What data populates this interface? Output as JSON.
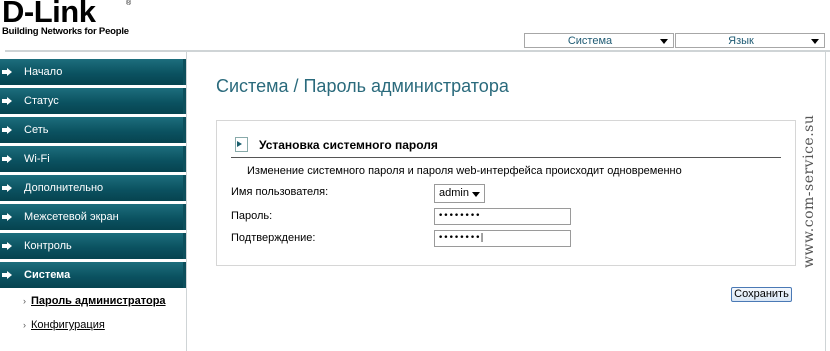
{
  "brand": {
    "logo_text": "D-Link",
    "registered_mark": "®",
    "tagline": "Building Networks for People"
  },
  "topbar": {
    "system_select": "Система",
    "language_select": "Язык"
  },
  "sidebar": {
    "items": [
      {
        "label": "Начало"
      },
      {
        "label": "Статус"
      },
      {
        "label": "Сеть"
      },
      {
        "label": "Wi-Fi"
      },
      {
        "label": "Дополнительно"
      },
      {
        "label": "Межсетевой экран"
      },
      {
        "label": "Контроль"
      },
      {
        "label": "Система"
      }
    ],
    "sub_items": [
      {
        "label": "Пароль администратора"
      },
      {
        "label": "Конфигурация"
      }
    ]
  },
  "main": {
    "title": "Система  / Пароль администратора",
    "section_title": "Установка системного пароля",
    "description": "Изменение системного пароля и пароля web-интерфейса происходит одновременно",
    "fields": {
      "username_label": "Имя пользователя:",
      "username_value": "admin",
      "password_label": "Пароль:",
      "password_value": "••••••••",
      "confirm_label": "Подтверждение:",
      "confirm_value": "••••••••|"
    },
    "save_label": "Сохранить"
  },
  "watermark": "www.com-service.su",
  "colors": {
    "nav_bg": "#0b5261",
    "title": "#2a6a7c",
    "top_select_text": "#1f5b74"
  }
}
